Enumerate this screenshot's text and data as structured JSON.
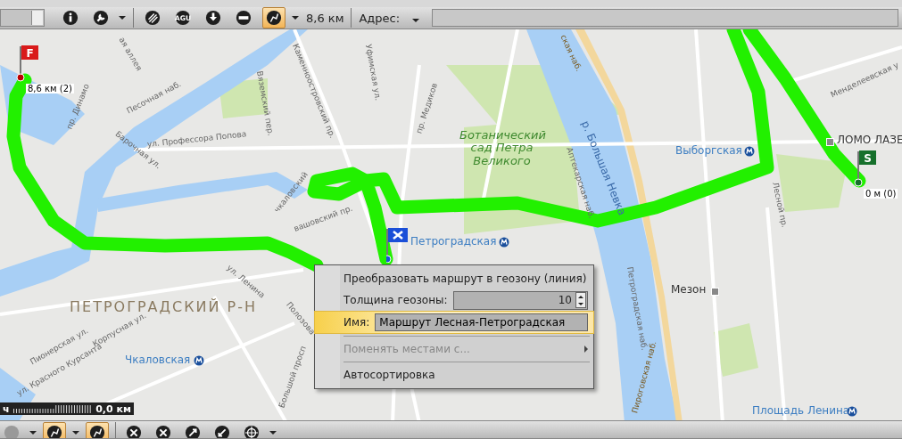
{
  "toolbar": {
    "tools": [
      {
        "kind": "info",
        "selected": false,
        "caret": false
      },
      {
        "kind": "wrench",
        "selected": false,
        "caret": true
      },
      {
        "kind": "hatch",
        "selected": false,
        "caret": false
      },
      {
        "kind": "agu",
        "selected": false,
        "caret": false,
        "text": "AGU"
      },
      {
        "kind": "download",
        "selected": false,
        "caret": false
      },
      {
        "kind": "ruler",
        "selected": false,
        "caret": false
      },
      {
        "kind": "route",
        "selected": true,
        "caret": true
      }
    ],
    "distance": "8,6 км",
    "address_label": "Адрес:"
  },
  "map": {
    "labels": [
      {
        "kind": "street",
        "text": "ая аллея"
      },
      {
        "kind": "street",
        "text": "Вяземский пер."
      },
      {
        "kind": "street",
        "text": "Каменноостровский пр."
      },
      {
        "kind": "street",
        "text": "Уфимская ул."
      },
      {
        "kind": "street",
        "text": "пр. Медиков"
      },
      {
        "kind": "street",
        "text": "пр. Динамо"
      },
      {
        "kind": "street",
        "text": "Песочная наб."
      },
      {
        "kind": "street",
        "text": "ул. Профессора Попова"
      },
      {
        "kind": "street",
        "text": "Барочная ул."
      },
      {
        "kind": "street",
        "text": "чкаловский"
      },
      {
        "kind": "street",
        "text": "вашовский пр."
      },
      {
        "kind": "metro",
        "text": "Петроградская"
      },
      {
        "kind": "district",
        "text": "ПЕТРОГРАДСКИЙ Р-Н"
      },
      {
        "kind": "street",
        "text": "ул. Ленина"
      },
      {
        "kind": "street",
        "text": "Пионерская ул."
      },
      {
        "kind": "street",
        "text": "Корпусная ул."
      },
      {
        "kind": "street",
        "text": "ул. Красного Курсанта"
      },
      {
        "kind": "metro",
        "text": "Чкаловская"
      },
      {
        "kind": "street",
        "text": "Полозова"
      },
      {
        "kind": "street",
        "text": "Большой просп"
      },
      {
        "kind": "park",
        "text": "Ботанический сад Петра Великого"
      },
      {
        "kind": "river",
        "text": "р. Большая Невка"
      },
      {
        "kind": "street",
        "text": "Аптекарская наб."
      },
      {
        "kind": "road",
        "text": "ская наб."
      },
      {
        "kind": "metro",
        "text": "Выборгская"
      },
      {
        "kind": "poi",
        "text": "ЛОМО ЛАЗЕ"
      },
      {
        "kind": "street",
        "text": "Менделеевская у"
      },
      {
        "kind": "street",
        "text": "Лесной пр."
      },
      {
        "kind": "poi",
        "text": "Мезон"
      },
      {
        "kind": "street",
        "text": "Петроградская наб."
      },
      {
        "kind": "road",
        "text": "Пироговская наб."
      },
      {
        "kind": "metro",
        "text": "Площадь Ленина"
      }
    ],
    "markers": [
      {
        "kind": "finish",
        "flag": "F",
        "caption": "8,6 км (2)"
      },
      {
        "kind": "waypoint"
      },
      {
        "kind": "start",
        "flag": "S",
        "caption": "0 м (0)"
      }
    ],
    "scale": {
      "unit_fragment": "ч",
      "reading": "0,0 км"
    }
  },
  "context_menu": {
    "items": [
      {
        "kind": "action",
        "label": "Преобразовать маршрут в геозону (линия)",
        "selected": false,
        "disabled": false
      },
      {
        "kind": "spinner",
        "label": "Толщина геозоны:",
        "value": "10",
        "selected": false,
        "disabled": false
      },
      {
        "kind": "field",
        "label": "Имя:",
        "value": "Маршрут Лесная-Петроградская",
        "selected": true,
        "disabled": false
      },
      {
        "kind": "separator"
      },
      {
        "kind": "submenu",
        "label": "Поменять местами с...",
        "selected": false,
        "disabled": true
      },
      {
        "kind": "separator"
      },
      {
        "kind": "action",
        "label": "Автосортировка",
        "selected": false,
        "disabled": false
      }
    ]
  },
  "bottom_toolbar": {
    "tools": [
      {
        "kind": "globe",
        "selected": false,
        "caret": true
      },
      {
        "kind": "pin",
        "selected": true,
        "caret": true
      },
      {
        "kind": "route",
        "selected": true,
        "caret": false
      },
      {
        "kind": "cross-circle",
        "selected": false,
        "caret": false
      },
      {
        "kind": "close",
        "selected": false,
        "caret": false
      },
      {
        "kind": "expand",
        "selected": false,
        "caret": false
      },
      {
        "kind": "collapse",
        "selected": false,
        "caret": false
      },
      {
        "kind": "crosshair",
        "selected": false,
        "caret": true
      }
    ]
  }
}
